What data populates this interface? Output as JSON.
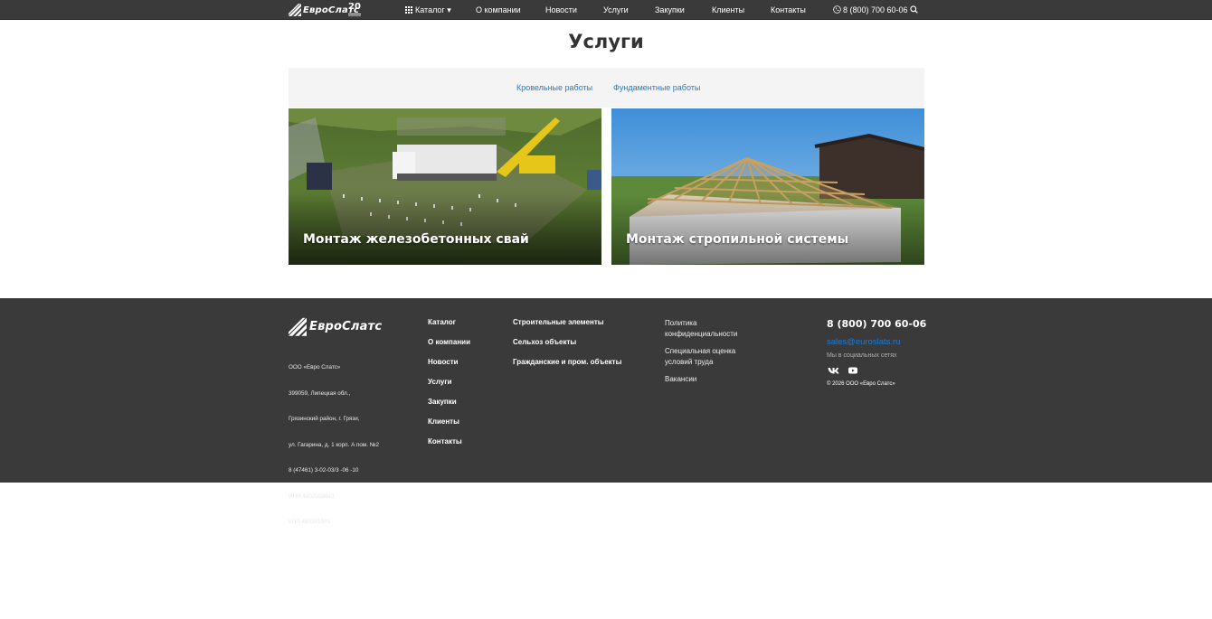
{
  "header": {
    "logo_text": "ЕвроСлатс",
    "anniversary_badge": "20",
    "nav": [
      {
        "label": "Каталог",
        "has_dropdown": true
      },
      {
        "label": "О компании"
      },
      {
        "label": "Новости"
      },
      {
        "label": "Услуги"
      },
      {
        "label": "Закупки"
      },
      {
        "label": "Клиенты"
      },
      {
        "label": "Контакты"
      }
    ],
    "phone": "8 (800) 700 60-06",
    "icons": [
      "grid-icon",
      "phone-icon",
      "search-icon"
    ]
  },
  "page": {
    "title": "Услуги",
    "tabs": [
      "Кровельные работы",
      "Фундаментные работы"
    ]
  },
  "cards": [
    {
      "caption": "Монтаж железобетонных свай"
    },
    {
      "caption": "Монтаж стропильной системы"
    }
  ],
  "footer": {
    "logo_text": "ЕвроСлатс",
    "address_lines": [
      "ООО «Евро Слатс»",
      "399059, Липецкая обл.,",
      "Грязинский район, г. Грязи,",
      "ул. Гагарина, д. 1 корп. А пом. №2",
      "8 (47461) 3-02-03/3 -06 -10",
      "ИНН 4802008643",
      "КПП 480201001"
    ],
    "col1": [
      "Каталог",
      "О компании",
      "Новости",
      "Услуги",
      "Закупки",
      "Клиенты",
      "Контакты"
    ],
    "col2": [
      "Строительные элементы",
      "Сельхоз объекты",
      "Гражданские и пром. объекты"
    ],
    "col3": [
      {
        "line1": "Политика",
        "line2": "конфиденциальности"
      },
      {
        "line1": "Специальная оценка",
        "line2": "условий труда"
      },
      {
        "line1": "Вакансии",
        "line2": ""
      }
    ],
    "phone": "8 (800) 700 60-06",
    "email": "sales@euroslats.ru",
    "social_label": "Мы в социальных сетях",
    "social_icons": [
      "vk-icon",
      "youtube-icon"
    ],
    "copyright": "© 2026 ООО «Евро Слатс»",
    "colors": {
      "background": "#3a3a3a",
      "link": "#1e7bd4"
    }
  }
}
